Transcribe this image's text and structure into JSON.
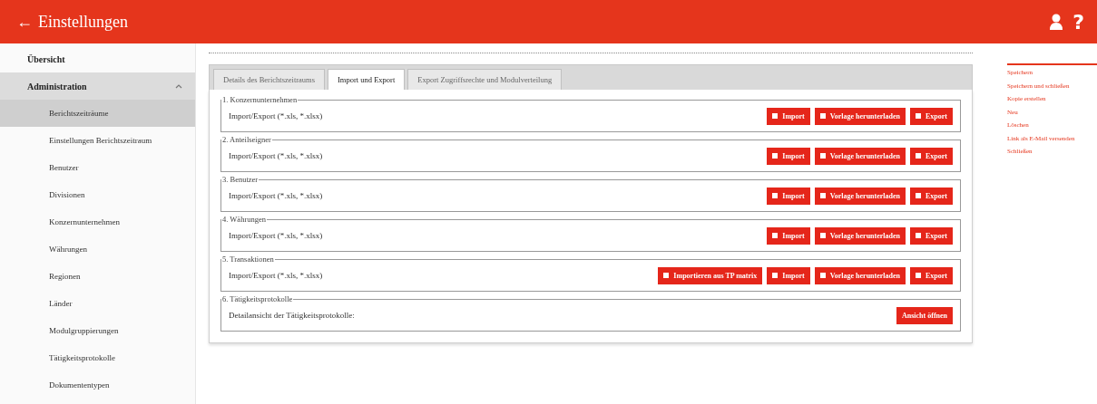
{
  "header": {
    "back_icon": "←",
    "title": "Einstellungen",
    "help": "?"
  },
  "sidebar": {
    "items": [
      {
        "label": "Übersicht",
        "selected": false
      },
      {
        "label": "Administration",
        "selected": false,
        "expanded": true,
        "children": [
          {
            "label": "Berichtszeiträume",
            "selected": true
          },
          {
            "label": "Einstellungen Berichtszeitraum",
            "selected": false
          },
          {
            "label": "Benutzer",
            "selected": false
          },
          {
            "label": "Divisionen",
            "selected": false
          },
          {
            "label": "Konzernunternehmen",
            "selected": false
          },
          {
            "label": "Währungen",
            "selected": false
          },
          {
            "label": "Regionen",
            "selected": false
          },
          {
            "label": "Länder",
            "selected": false
          },
          {
            "label": "Modulgruppierungen",
            "selected": false
          },
          {
            "label": "Tätigkeitsprotokolle",
            "selected": false
          },
          {
            "label": "Dokumententypen",
            "selected": false
          }
        ]
      }
    ]
  },
  "tabs": [
    {
      "label": "Details des Berichtszeitraums",
      "selected": false
    },
    {
      "label": "Import und Export",
      "selected": true
    },
    {
      "label": "Export Zugriffsrechte und Modulverteilung",
      "selected": false
    }
  ],
  "sections": [
    {
      "title": "1. Konzernunternehmen",
      "text": "Import/Export (*.xls, *.xlsx)",
      "buttons": [
        {
          "label": "Import",
          "kind": "icon"
        },
        {
          "label": "Vorlage herunterladen",
          "kind": "icon"
        },
        {
          "label": "Export",
          "kind": "icon"
        }
      ]
    },
    {
      "title": "2. Anteilseigner",
      "text": "Import/Export (*.xls, *.xlsx)",
      "buttons": [
        {
          "label": "Import",
          "kind": "icon"
        },
        {
          "label": "Vorlage herunterladen",
          "kind": "icon"
        },
        {
          "label": "Export",
          "kind": "icon"
        }
      ]
    },
    {
      "title": "3. Benutzer",
      "text": "Import/Export (*.xls, *.xlsx)",
      "buttons": [
        {
          "label": "Import",
          "kind": "icon"
        },
        {
          "label": "Vorlage herunterladen",
          "kind": "icon"
        },
        {
          "label": "Export",
          "kind": "icon"
        }
      ]
    },
    {
      "title": "4. Währungen",
      "text": "Import/Export (*.xls, *.xlsx)",
      "buttons": [
        {
          "label": "Import",
          "kind": "icon"
        },
        {
          "label": "Vorlage herunterladen",
          "kind": "icon"
        },
        {
          "label": "Export",
          "kind": "icon"
        }
      ]
    },
    {
      "title": "5. Transaktionen",
      "text": "Import/Export (*.xls, *.xlsx)",
      "buttons": [
        {
          "label": "Importieren aus TP matrix",
          "kind": "icon"
        },
        {
          "label": "Import",
          "kind": "icon"
        },
        {
          "label": "Vorlage herunterladen",
          "kind": "icon"
        },
        {
          "label": "Export",
          "kind": "icon"
        }
      ]
    },
    {
      "title": "6. Tätigkeitsprotokolle",
      "text": "Detailansicht der Tätigkeitsprotokolle:",
      "buttons": [
        {
          "label": "Ansicht öffnen",
          "kind": "plain"
        }
      ]
    }
  ],
  "actions": [
    "Speichern",
    "Speichern und schließen",
    "Kopie erstellen",
    "Neu",
    "Löschen",
    "Link als E-Mail versenden",
    "Schließen"
  ]
}
